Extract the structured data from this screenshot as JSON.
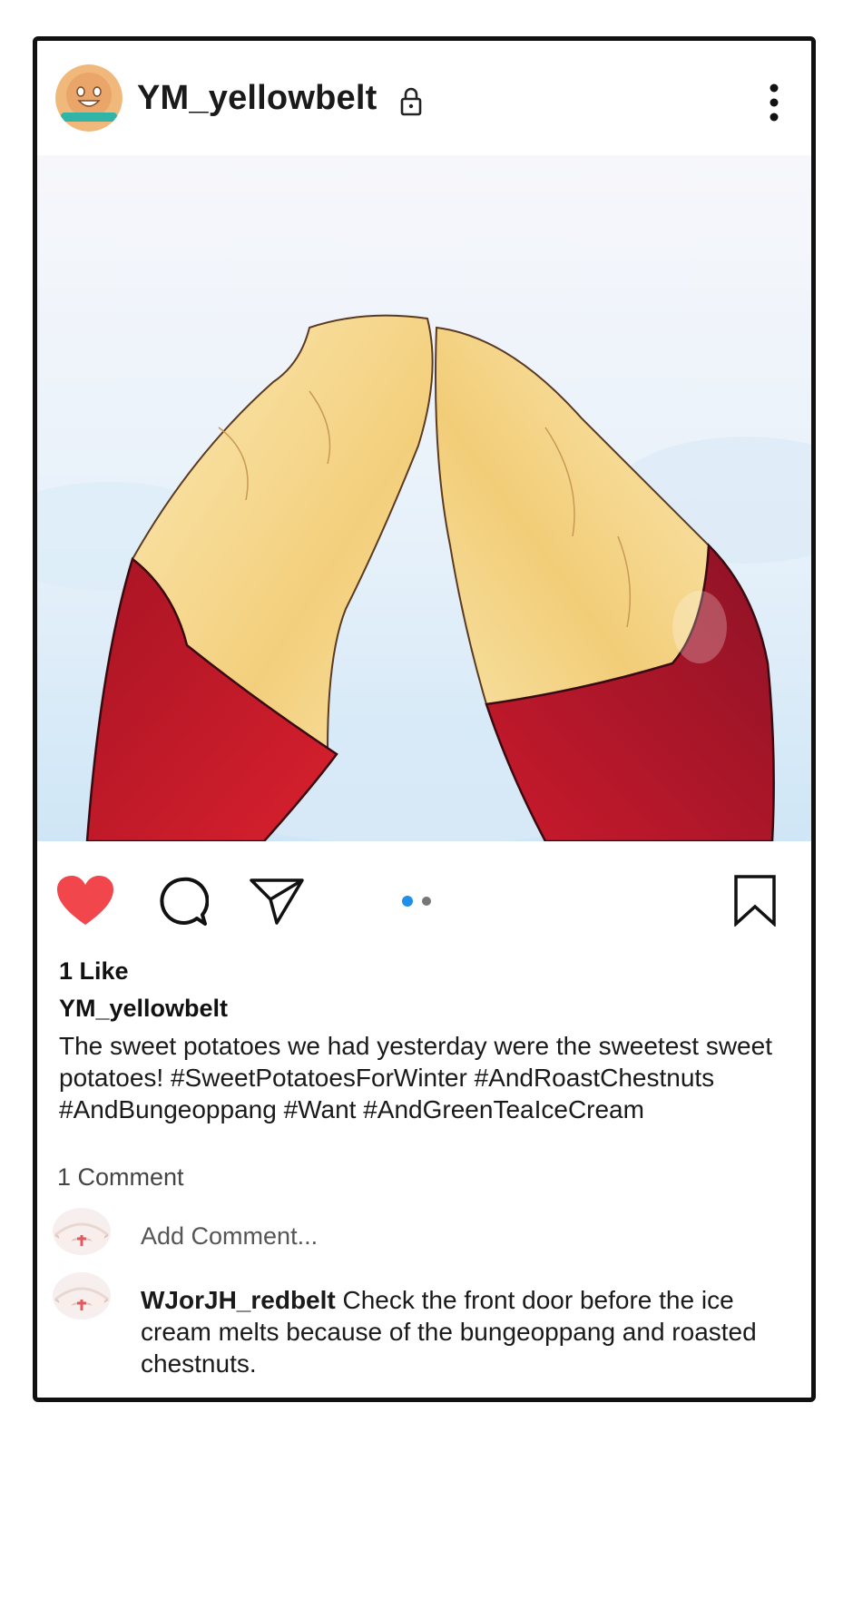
{
  "post": {
    "username": "YM_yellowbelt",
    "header_icons": {
      "lock": "lock-icon",
      "more": "more-vertical-icon"
    },
    "actions": {
      "like_icon": "heart-icon",
      "comment_icon": "comment-icon",
      "share_icon": "share-icon",
      "save_icon": "bookmark-icon",
      "carousel_pages": 2,
      "carousel_active": 1
    },
    "likes": "1 Like",
    "caption_user": "YM_yellowbelt",
    "caption": "The sweet potatoes we had yesterday were the sweetest sweet potatoes! #SweetPotatoesForWinter #AndRoastChestnuts #AndBungeoppang #Want #AndGreenTeaIceCream",
    "comment_count": "1 Comment",
    "add_comment_placeholder": "Add Comment...",
    "comments": [
      {
        "user": "WJorJH_redbelt",
        "text": "Check the front door before the ice cream melts because of the bungeoppang and roasted chestnuts."
      }
    ]
  },
  "colors": {
    "like_red": "#f0464c",
    "dot_active": "#1e90e8",
    "dot_inactive": "#777777",
    "potato_skin": "#c4182a",
    "potato_flesh": "#f6d98c",
    "sky": "#d6ebf8"
  }
}
